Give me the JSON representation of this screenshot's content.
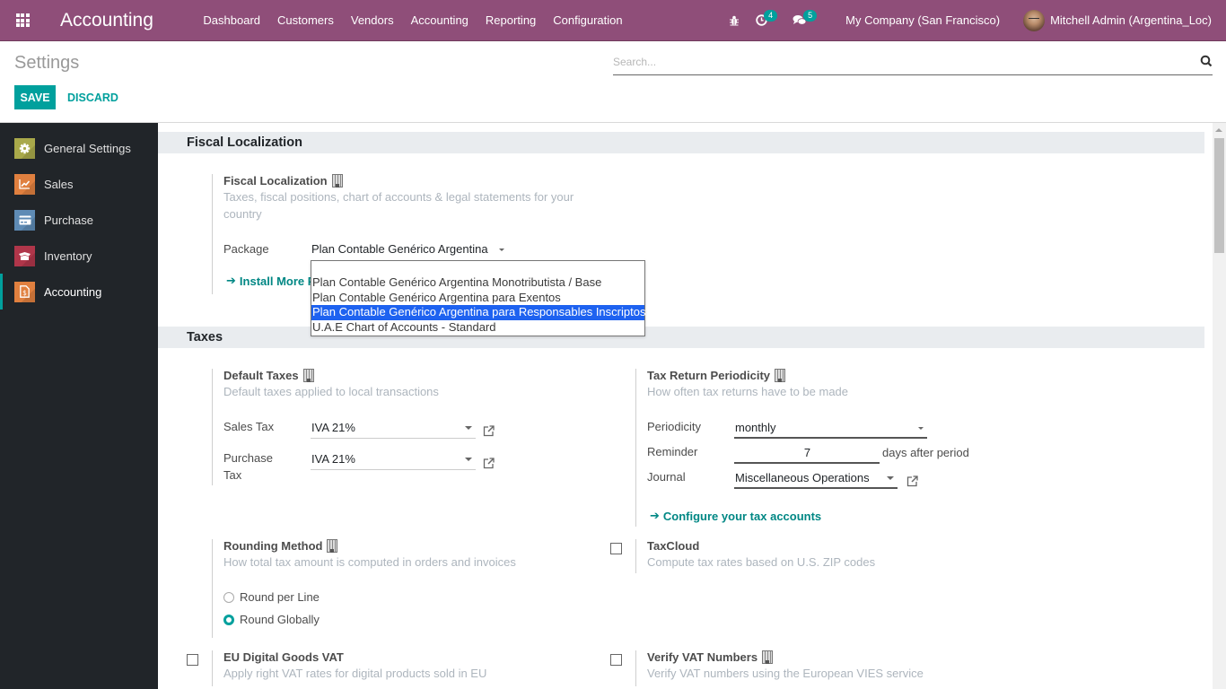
{
  "navbar": {
    "app_title": "Accounting",
    "menu": [
      "Dashboard",
      "Customers",
      "Vendors",
      "Accounting",
      "Reporting",
      "Configuration"
    ],
    "activity_count": "4",
    "message_count": "5",
    "company": "My Company (San Francisco)",
    "user": "Mitchell Admin (Argentina_Loc)"
  },
  "control_panel": {
    "title": "Settings",
    "search_placeholder": "Search...",
    "save_label": "SAVE",
    "discard_label": "DISCARD"
  },
  "sidebar": {
    "items": [
      {
        "label": "General Settings",
        "icon": "gear-icon",
        "color": "#a9a94a",
        "active": false
      },
      {
        "label": "Sales",
        "icon": "chart-trend-icon",
        "color": "#e0803f",
        "active": false
      },
      {
        "label": "Purchase",
        "icon": "credit-card-icon",
        "color": "#5e8bb5",
        "active": false
      },
      {
        "label": "Inventory",
        "icon": "box-icon",
        "color": "#b0364a",
        "active": false
      },
      {
        "label": "Accounting",
        "icon": "invoice-dollar-icon",
        "color": "#e0803f",
        "active": true
      }
    ]
  },
  "fiscal": {
    "section_title": "Fiscal Localization",
    "setting_title": "Fiscal Localization",
    "setting_desc": "Taxes, fiscal positions, chart of accounts & legal statements for your country",
    "package_label": "Package",
    "package_value": "Plan Contable Genérico Argentina par",
    "install_more": "Install More P",
    "dropdown_options": [
      {
        "label": "",
        "selected": false
      },
      {
        "label": "Plan Contable Genérico Argentina Monotributista / Base",
        "selected": false
      },
      {
        "label": "Plan Contable Genérico Argentina para Exentos",
        "selected": false
      },
      {
        "label": "Plan Contable Genérico Argentina para Responsables Inscriptos",
        "selected": true
      },
      {
        "label": "U.A.E Chart of Accounts - Standard",
        "selected": false
      }
    ]
  },
  "taxes": {
    "section_title": "Taxes",
    "default_taxes": {
      "title": "Default Taxes",
      "desc": "Default taxes applied to local transactions",
      "sales_tax_label": "Sales Tax",
      "sales_tax_value": "IVA 21%",
      "purchase_tax_label_1": "Purchase",
      "purchase_tax_label_2": "Tax",
      "purchase_tax_value": "IVA 21%"
    },
    "periodicity": {
      "title": "Tax Return Periodicity",
      "desc": "How often tax returns have to be made",
      "periodicity_label": "Periodicity",
      "periodicity_value": "monthly",
      "reminder_label": "Reminder",
      "reminder_value": "7",
      "reminder_suffix": "days after period",
      "journal_label": "Journal",
      "journal_value": "Miscellaneous Operations",
      "configure_link": "Configure your tax accounts"
    },
    "rounding": {
      "title": "Rounding Method",
      "desc": "How total tax amount is computed in orders and invoices",
      "options": [
        {
          "label": "Round per Line",
          "checked": false
        },
        {
          "label": "Round Globally",
          "checked": true
        }
      ]
    },
    "taxcloud": {
      "title": "TaxCloud",
      "desc": "Compute tax rates based on U.S. ZIP codes",
      "checked": false
    },
    "eu_digital": {
      "title": "EU Digital Goods VAT",
      "desc": "Apply right VAT rates for digital products sold in EU",
      "checked": false
    },
    "verify_vat": {
      "title": "Verify VAT Numbers",
      "desc": "Verify VAT numbers using the European VIES service",
      "checked": false
    }
  }
}
